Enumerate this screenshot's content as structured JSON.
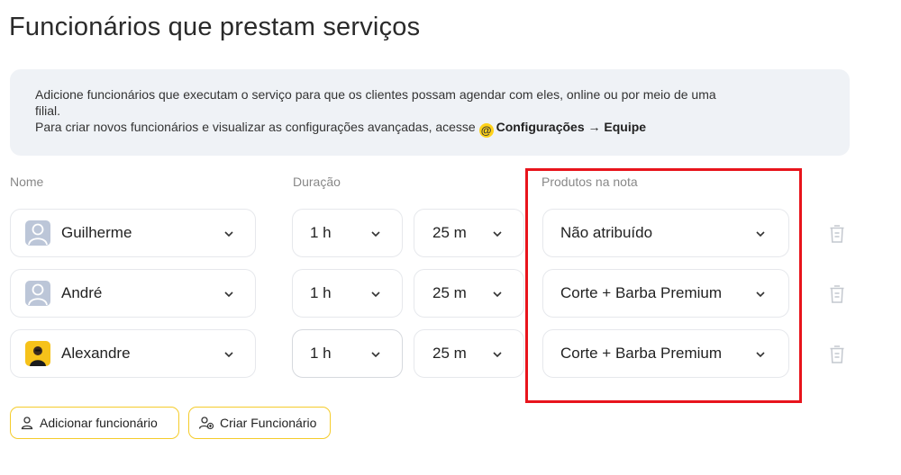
{
  "page_title": "Funcionários que prestam serviços",
  "info": {
    "line1": "Adicione funcionários que executam o serviço para que os clientes possam agendar com eles, online ou por meio de uma",
    "line2": "filial.",
    "line3": "Para criar novos funcionários e visualizar as configurações avançadas, acesse",
    "link_text": "Configurações → Equipe",
    "link_icon": "link-icon"
  },
  "columns": {
    "name": "Nome",
    "duration": "Duração",
    "products": "Produtos na nota"
  },
  "rows": [
    {
      "name": "Guilherme",
      "avatar": "placeholder",
      "hours": "1 h",
      "minutes": "25 m",
      "product": "Não atribuído"
    },
    {
      "name": "André",
      "avatar": "placeholder",
      "hours": "1 h",
      "minutes": "25 m",
      "product": "Corte + Barba Premium"
    },
    {
      "name": "Alexandre",
      "avatar": "photo",
      "hours": "1 h",
      "minutes": "25 m",
      "product": "Corte + Barba Premium"
    }
  ],
  "buttons": {
    "add_employee": "Adicionar funcionário",
    "create_employee": "Criar Funcionário"
  },
  "colors": {
    "accent_yellow": "#f5cc2b",
    "highlight_red": "#e8141c",
    "info_bg": "#eff2f6"
  }
}
